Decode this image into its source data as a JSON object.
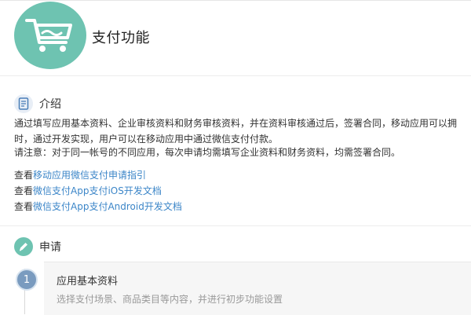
{
  "header": {
    "title": "支付功能",
    "icon": "shopping-cart-icon",
    "circle_color": "#6ec3b1"
  },
  "intro": {
    "heading": "介绍",
    "icon": "document-icon",
    "line1": "通过填写应用基本资料、企业审核资料和财务审核资料，并在资料审核通过后，签署合同，移动应用可以拥",
    "line2": "时，通过开发实现，用户可以在移动应用中通过微信支付付款。",
    "note": "请注意：对于同一帐号的不同应用，每次申请均需填写企业资料和财务资料，均需签署合同。",
    "links": [
      {
        "prefix": "查看",
        "text": "移动应用微信支付申请指引"
      },
      {
        "prefix": "查看",
        "text": "微信支付App支付iOS开发文档"
      },
      {
        "prefix": "查看",
        "text": "微信支付App支付Android开发文档"
      }
    ],
    "link_color": "#3c86c8"
  },
  "apply": {
    "heading": "申请",
    "icon": "pen-icon",
    "steps": [
      {
        "number": "1",
        "title": "应用基本资料",
        "desc": "选择支付场景、商品类目等内容，并进行初步功能设置"
      }
    ]
  }
}
